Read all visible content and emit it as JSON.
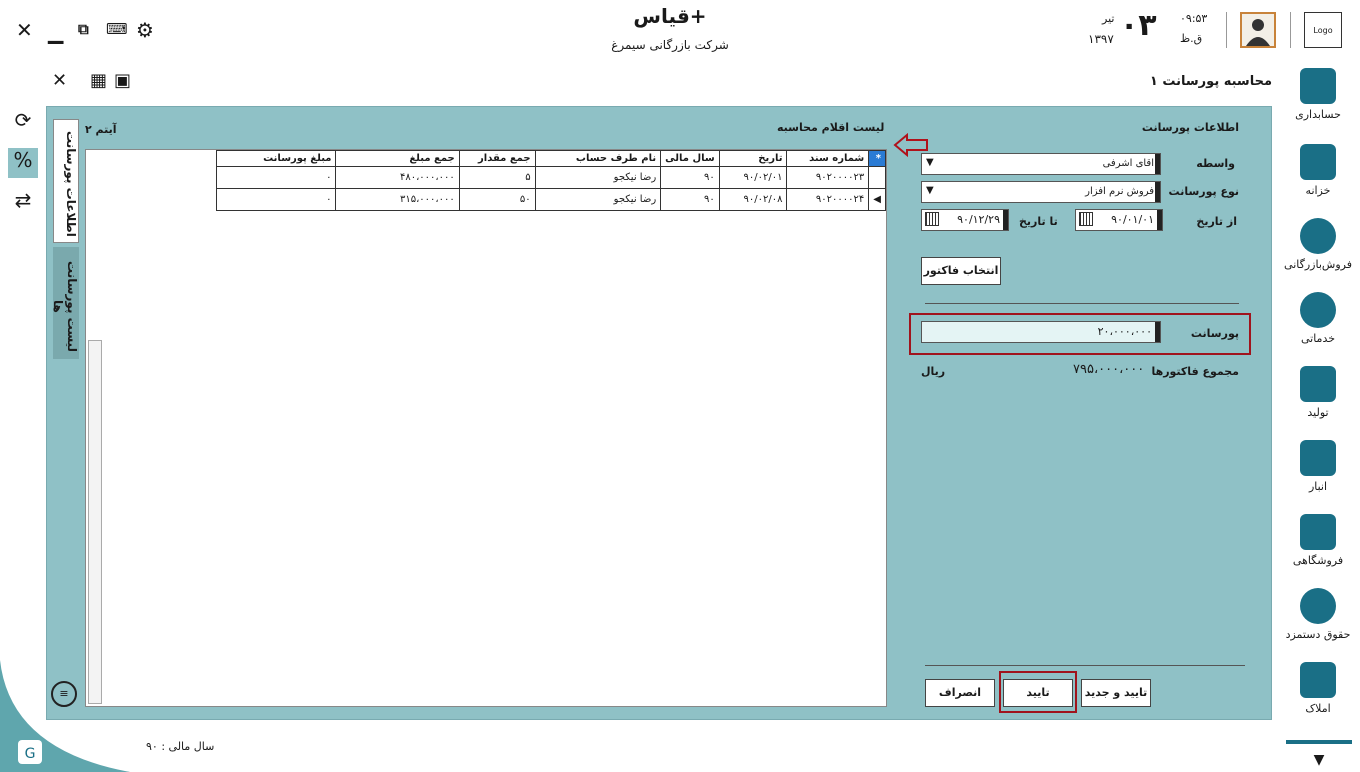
{
  "app": {
    "title": "قیاس+",
    "company": "شرکت بازرگانی سیمرغ",
    "logo_text": "Logo",
    "day": "۰۳",
    "month": "تیر",
    "year": "۱۳۹۷",
    "time": "۰۹:۵۳",
    "ampm": "ق.ظ"
  },
  "page": {
    "title": "محاسبه پورسانت ۱"
  },
  "nav": [
    {
      "label": "حسابداری",
      "icon": "accounting-icon"
    },
    {
      "label": "خزانه",
      "icon": "safe-icon"
    },
    {
      "label": "فروش‌بازرگانی",
      "icon": "globe-sales-icon"
    },
    {
      "label": "خدماتی",
      "icon": "gear-services-icon"
    },
    {
      "label": "تولید",
      "icon": "production-icon"
    },
    {
      "label": "انبار",
      "icon": "warehouse-icon"
    },
    {
      "label": "فروشگاهی",
      "icon": "store-icon"
    },
    {
      "label": "حقوق دستمزد",
      "icon": "coins-icon"
    },
    {
      "label": "املاک",
      "icon": "house-icon"
    }
  ],
  "form": {
    "section_title": "اطلاعات پورسانت",
    "agent_label": "واسطه",
    "agent_value": "اقای اشرفی",
    "type_label": "نوع پورسانت",
    "type_value": "فروش نرم افزار",
    "from_label": "از تاریخ",
    "from_value": "۹۰/۰۱/۰۱",
    "to_label": "تا تاریخ",
    "to_value": "۹۰/۱۲/۲۹",
    "select_invoice": "انتخاب فاکتور",
    "commission_label": "پورسانت",
    "commission_value": "۲۰،۰۰۰،۰۰۰",
    "invoice_total_label": "مجموع فاکتورها",
    "invoice_total_value": "۷۹۵،۰۰۰،۰۰۰",
    "currency": "ریال"
  },
  "buttons": {
    "confirm_new": "تایید و جدید",
    "confirm": "تایید",
    "cancel": "انصراف"
  },
  "list": {
    "title": "لیست اقلام محاسبه",
    "count": "۲ آیتم",
    "columns": [
      "شماره سند",
      "تاریخ",
      "سال مالی",
      "نام طرف حساب",
      "جمع مقدار",
      "جمع مبلغ",
      "مبلغ پورسانت"
    ],
    "rows": [
      [
        "۹۰۲۰۰۰۰۲۳",
        "۹۰/۰۲/۰۱",
        "۹۰",
        "رضا نیکجو",
        "۵",
        "۴۸۰،۰۰۰،۰۰۰",
        "۰"
      ],
      [
        "۹۰۲۰۰۰۰۲۴",
        "۹۰/۰۲/۰۸",
        "۹۰",
        "رضا نیکجو",
        "۵۰",
        "۳۱۵،۰۰۰،۰۰۰",
        "۰"
      ]
    ]
  },
  "tabs": {
    "info": "اطلاعات پورسانت",
    "list": "لیست پورسانت ها"
  },
  "status": {
    "fiscal_year": "سال مالی : ۹۰"
  }
}
